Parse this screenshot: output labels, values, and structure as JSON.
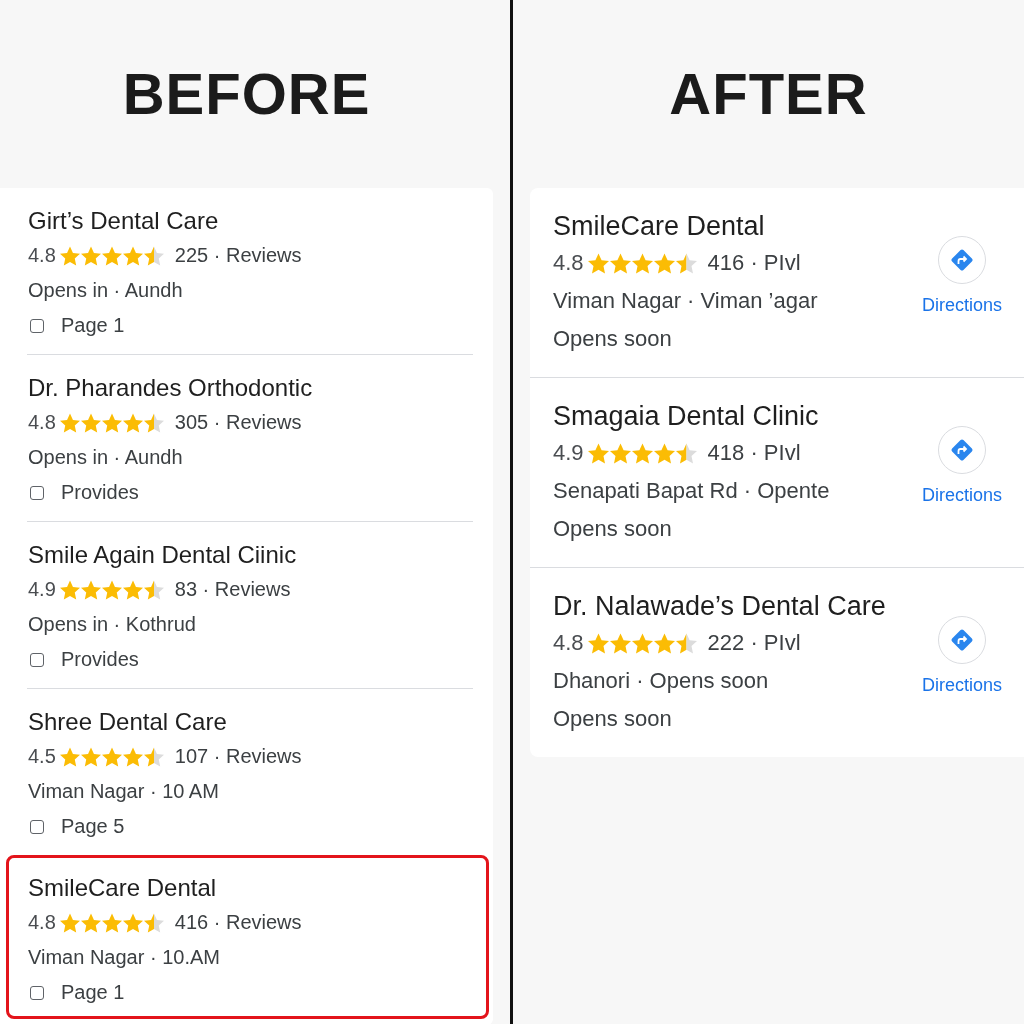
{
  "before": {
    "heading": "BEFORE",
    "results": [
      {
        "name": "Girt’s Dental Care",
        "rating": "4.8",
        "stars": 4.5,
        "reviews": "225 · Reviews",
        "location": "Opens in · Aundh",
        "page": "Page 1",
        "checked": false,
        "selected": false
      },
      {
        "name": "Dr. Pharandes Orthodontic",
        "rating": "4.8",
        "stars": 4.5,
        "reviews": "305 · Reviews",
        "location": "Opens in · Aundh",
        "page": "Provides",
        "checked": false,
        "selected": false
      },
      {
        "name": "Smile Again Dental Ciinic",
        "rating": "4.9",
        "stars": 4.5,
        "reviews": "83 · Reviews",
        "location": "Opens in · Kothrud",
        "page": "Provides",
        "checked": false,
        "selected": false
      },
      {
        "name": "Shree Dental Care",
        "rating": "4.5",
        "stars": 4.5,
        "reviews": "107 · Reviews",
        "location": "Viman Nagar · 10 AM",
        "page": "Page 5",
        "checked": false,
        "selected": false
      },
      {
        "name": "SmileCare Dental",
        "rating": "4.8",
        "stars": 4.5,
        "reviews": "416 · Reviews",
        "location": "Viman Nagar · 10.AM",
        "page": "Page 1",
        "checked": false,
        "selected": true
      }
    ]
  },
  "after": {
    "heading": "AFTER",
    "results": [
      {
        "name": "SmileCare Dental",
        "rating": "4.8",
        "stars": 4.5,
        "reviews": "416 · PIvl",
        "location": "Viman Nagar · Viman ’agar",
        "status": "Opens soon",
        "action": "Directions"
      },
      {
        "name": "Smagaia Dental Clinic",
        "rating": "4.9",
        "stars": 4.5,
        "reviews": "418 · PIvl",
        "location": "Senapati Bapat Rd · Opente",
        "status": "Opens soon",
        "action": "Directions"
      },
      {
        "name": "Dr. Nalawade’s Dental Care",
        "rating": "4.8",
        "stars": 4.5,
        "reviews": "222 · PIvl",
        "location": "Dhanori · Opens soon",
        "status": "Opens soon",
        "action": "Directions"
      }
    ]
  }
}
